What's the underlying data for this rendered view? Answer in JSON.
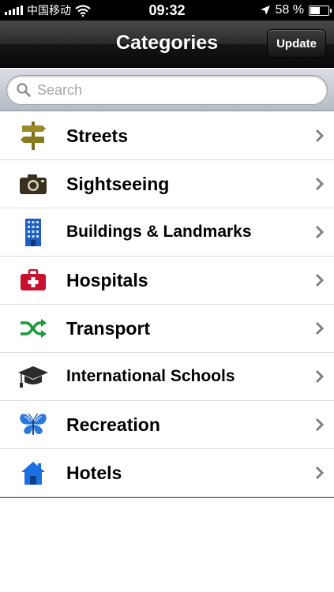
{
  "status_bar": {
    "carrier": "中国移动",
    "time": "09:32",
    "battery_percent": "58 %",
    "battery_level": 0.58
  },
  "nav": {
    "title": "Categories",
    "update_label": "Update"
  },
  "search": {
    "placeholder": "Search",
    "value": ""
  },
  "categories": [
    {
      "label": "Streets",
      "icon": "signpost-icon",
      "color": "#8a7a1e"
    },
    {
      "label": "Sightseeing",
      "icon": "camera-icon",
      "color": "#3a3020"
    },
    {
      "label": "Buildings & Landmarks",
      "icon": "building-icon",
      "color": "#1f5fbf"
    },
    {
      "label": "Hospitals",
      "icon": "first-aid-icon",
      "color": "#c8102e"
    },
    {
      "label": "Transport",
      "icon": "shuffle-icon",
      "color": "#1a9a3c"
    },
    {
      "label": "International Schools",
      "icon": "graduation-cap-icon",
      "color": "#2b2b2b"
    },
    {
      "label": "Recreation",
      "icon": "butterfly-icon",
      "color": "#2b78d8"
    },
    {
      "label": "Hotels",
      "icon": "house-icon",
      "color": "#1c6fe0"
    }
  ],
  "colors": {
    "nav_bg": "#1a1a1a",
    "chevron": "#808080",
    "separator": "#dcdcdc"
  }
}
